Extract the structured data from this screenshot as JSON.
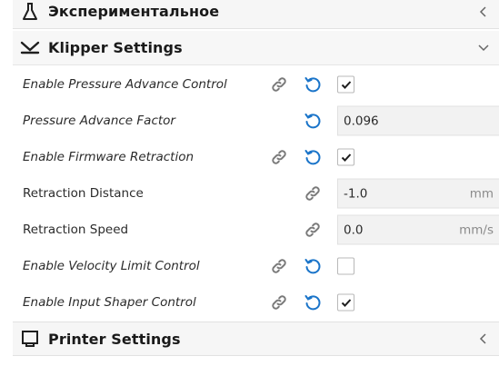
{
  "categories": {
    "experimental": {
      "label": "Экспериментальное",
      "icon": "flask-icon",
      "state": "collapsed"
    },
    "klipper": {
      "label": "Klipper Settings",
      "icon": "klipper-logo-icon",
      "state": "expanded"
    },
    "printer": {
      "label": "Printer Settings",
      "icon": "printer-icon",
      "state": "collapsed"
    }
  },
  "settings": [
    {
      "label": "Enable Pressure Advance Control",
      "type": "checkbox",
      "checked": true,
      "linked": true,
      "resettable": true
    },
    {
      "label": "Pressure Advance Factor",
      "type": "number",
      "value": "0.096",
      "unit": "",
      "linked": false,
      "resettable": true
    },
    {
      "label": "Enable Firmware Retraction",
      "type": "checkbox",
      "checked": true,
      "linked": true,
      "resettable": true
    },
    {
      "label": "Retraction Distance",
      "type": "number",
      "value": "-1.0",
      "unit": "mm",
      "linked": true,
      "resettable": false
    },
    {
      "label": "Retraction Speed",
      "type": "number",
      "value": "0.0",
      "unit": "mm/s",
      "linked": true,
      "resettable": false
    },
    {
      "label": "Enable Velocity Limit Control",
      "type": "checkbox",
      "checked": false,
      "linked": true,
      "resettable": true
    },
    {
      "label": "Enable Input Shaper Control",
      "type": "checkbox",
      "checked": true,
      "linked": true,
      "resettable": true
    }
  ],
  "colors": {
    "reset_blue": "#1a74c9",
    "link_gray": "#7a7a7a",
    "header_bg": "#f6f6f6"
  }
}
